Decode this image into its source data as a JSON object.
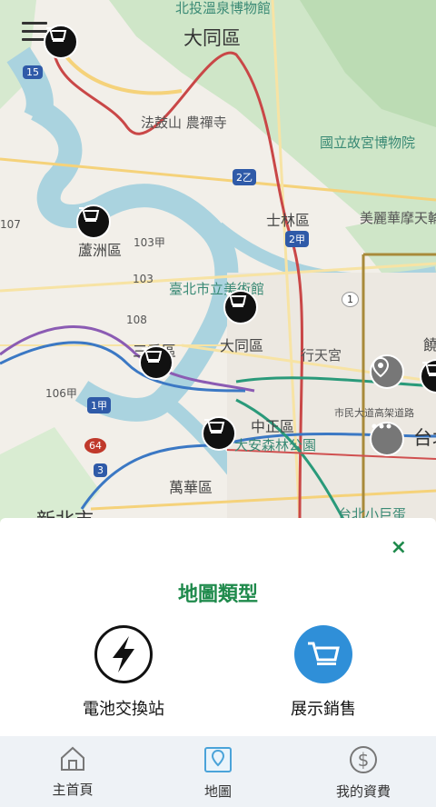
{
  "map": {
    "labels": {
      "beitou_museum": "北投溫泉博物館",
      "datong_top": "大同區",
      "fagushan": "法鼓山 農禪寺",
      "palace_museum": "國立故宮博物院",
      "shilin": "士林區",
      "miramar": "美麗華摩天輪",
      "luzhou": "蘆洲區",
      "fine_arts": "臺北市立美術館",
      "datong": "大同區",
      "xingtian": "行天宮",
      "sanchong": "三重區",
      "zhongzheng": "中正區",
      "daan_park": "大安森林公園",
      "expressway": "市民大道高架道路",
      "wanhua": "萬華區",
      "new_taipei": "新北市",
      "taipei_arena": "台北小巨蛋",
      "tai": "台北",
      "edge": "饒"
    },
    "road_shields": {
      "r15": "15",
      "r2z": "2乙",
      "r2jia": "2甲",
      "r107": "107",
      "r103jia": "103甲",
      "r103": "103",
      "r108": "108",
      "r106jia": "106甲",
      "r1jia": "1甲",
      "r64": "64",
      "r3": "3",
      "r1": "1"
    }
  },
  "sheet": {
    "title": "地圖類型",
    "close_label": "×",
    "options": [
      {
        "label": "電池交換站",
        "icon": "lightning-icon"
      },
      {
        "label": "展示銷售",
        "icon": "shopping-cart-icon"
      }
    ]
  },
  "nav": {
    "items": [
      {
        "label": "主首頁",
        "icon": "home-icon"
      },
      {
        "label": "地圖",
        "icon": "map-icon",
        "active": true
      },
      {
        "label": "我的資費",
        "icon": "dollar-icon"
      }
    ]
  },
  "colors": {
    "accent_green": "#1f8a4c",
    "cart_blue": "#2f8fd8",
    "nav_bg": "#eef2f6"
  }
}
